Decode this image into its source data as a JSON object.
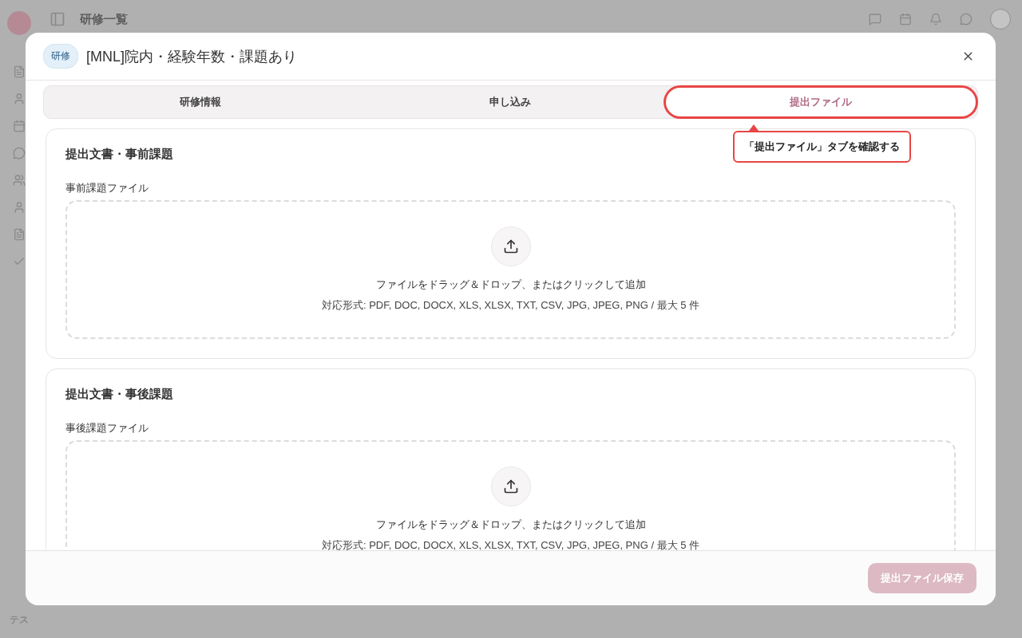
{
  "background": {
    "page_title": "研修一覧",
    "avatar": "テス"
  },
  "dialog": {
    "badge": "研修",
    "title": "[MNL]院内・経験年数・課題あり",
    "tabs": [
      {
        "label": "研修情報",
        "selected": false,
        "highlighted": false
      },
      {
        "label": "申し込み",
        "selected": false,
        "highlighted": false
      },
      {
        "label": "提出ファイル",
        "selected": true,
        "highlighted": true
      }
    ],
    "callout": "「提出ファイル」タブを確認する",
    "sections": [
      {
        "heading": "提出文書・事前課題",
        "field_label": "事前課題ファイル",
        "prompt": "ファイルをドラッグ＆ドロップ、またはクリックして追加",
        "formats": "対応形式: PDF, DOC, DOCX, XLS, XLSX, TXT, CSV, JPG, JPEG, PNG / 最大 5 件"
      },
      {
        "heading": "提出文書・事後課題",
        "field_label": "事後課題ファイル",
        "prompt": "ファイルをドラッグ＆ドロップ、またはクリックして追加",
        "formats": "対応形式: PDF, DOC, DOCX, XLS, XLSX, TXT, CSV, JPG, JPEG, PNG / 最大 5 件"
      }
    ],
    "save_button": {
      "label": "提出ファイル保存",
      "disabled": true
    }
  }
}
